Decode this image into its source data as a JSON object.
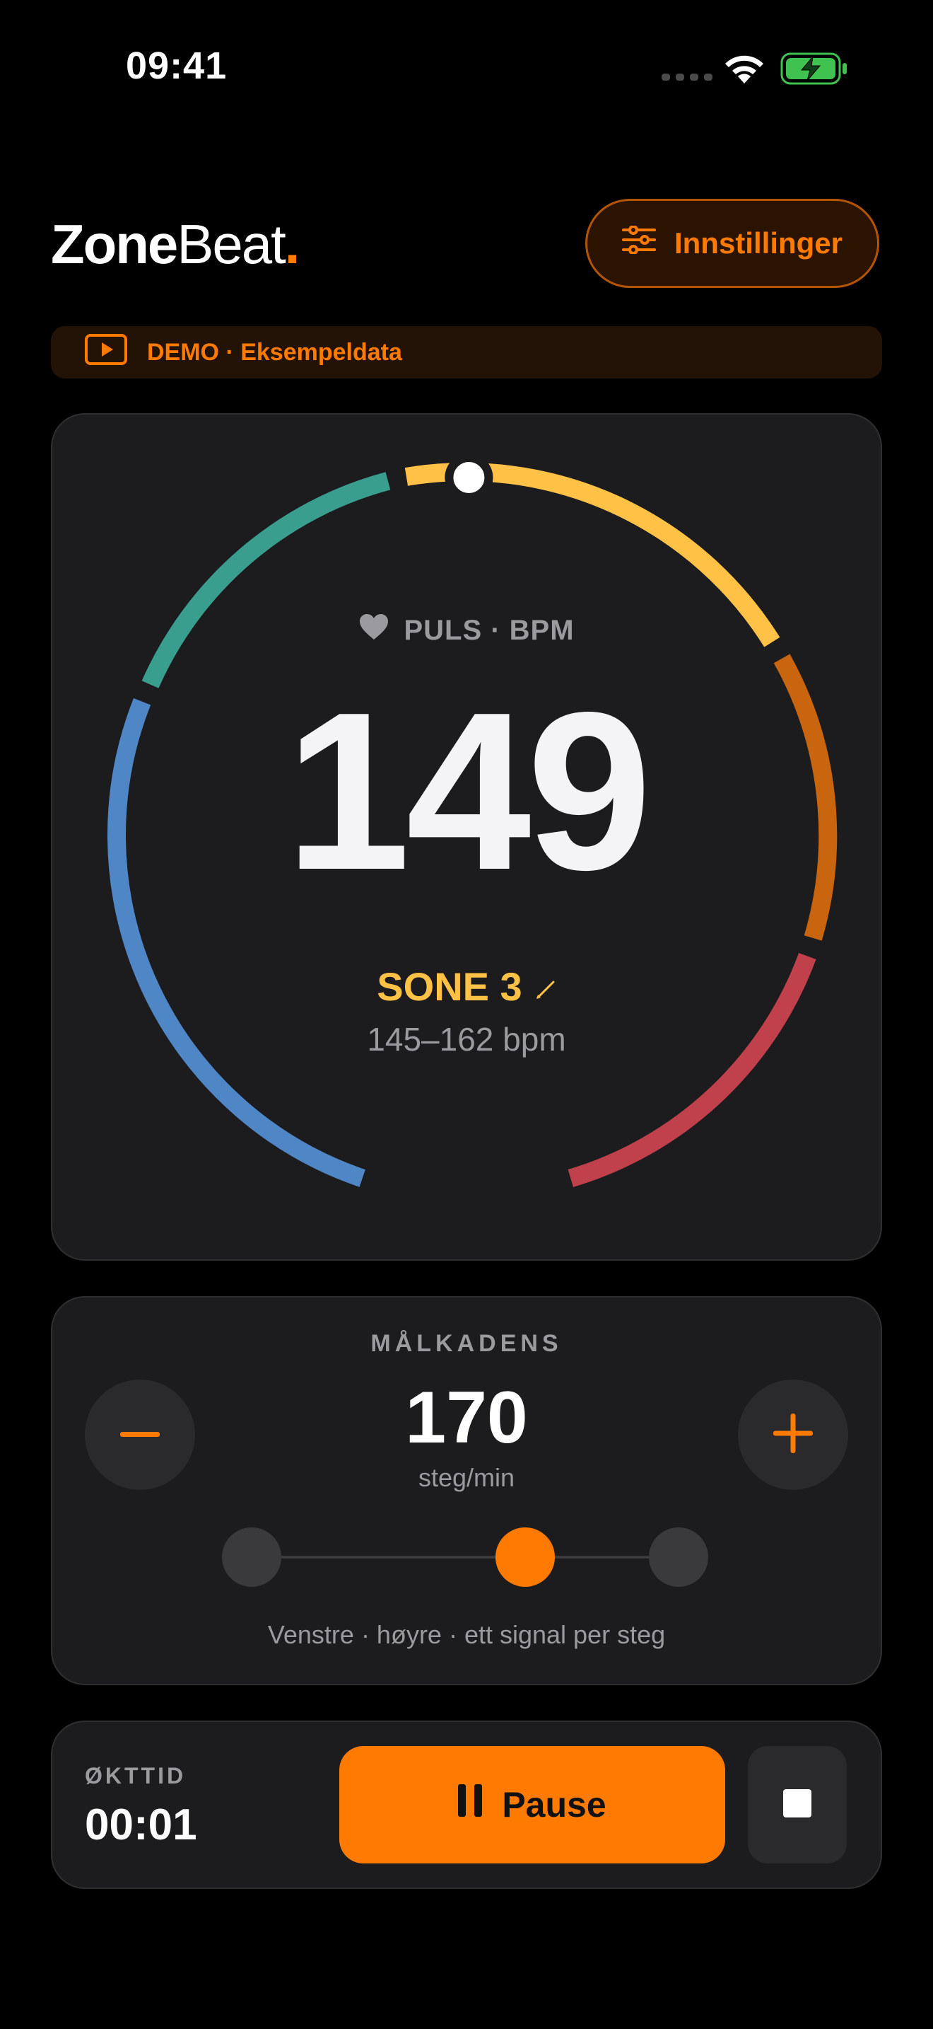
{
  "status_bar": {
    "time": "09:41"
  },
  "header": {
    "logo_part1": "Zone",
    "logo_part2": "Beat",
    "logo_dot": ".",
    "settings_label": "Innstillinger"
  },
  "demo_banner": {
    "text": "DEMO · Eksempeldata"
  },
  "heart_rate": {
    "label": "PULS · BPM",
    "value": "149",
    "zone": "SONE 3",
    "range": "145–162 bpm",
    "indicator_fraction": 0.125,
    "zone_colors": [
      "#4f86c6",
      "#3a9e8f",
      "#ffc247",
      "#c9650e",
      "#c0414b"
    ]
  },
  "cadence": {
    "title": "MÅLKADENS",
    "value": "170",
    "unit": "steg/min",
    "active_step": 1,
    "step_count": 3,
    "hint": "Venstre · høyre · ett signal per steg"
  },
  "session": {
    "label": "ØKTTID",
    "elapsed": "00:01",
    "pause_label": "Pause"
  },
  "colors": {
    "accent": "#ff7a00",
    "zone3": "#ffc247",
    "card": "#1c1c1e"
  }
}
